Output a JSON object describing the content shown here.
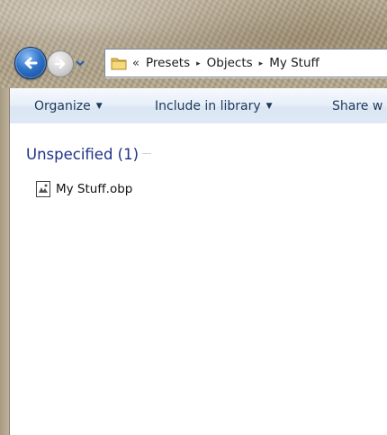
{
  "address_bar": {
    "overflow_chevron": "«",
    "breadcrumbs": [
      "Presets",
      "Objects",
      "My Stuff"
    ],
    "separator": "▸"
  },
  "command_bar": {
    "organize_label": "Organize",
    "include_label": "Include in library",
    "share_label": "Share w",
    "dropdown_arrow": "▼"
  },
  "content": {
    "group_header": "Unspecified (1)",
    "files": [
      {
        "name": "My Stuff.obp",
        "icon": "obp-file-icon"
      }
    ]
  },
  "colors": {
    "group_header": "#1e3287",
    "command_text": "#1e395b",
    "command_bar_top": "#f6f9fd",
    "command_bar_bottom": "#dbe6f4"
  }
}
